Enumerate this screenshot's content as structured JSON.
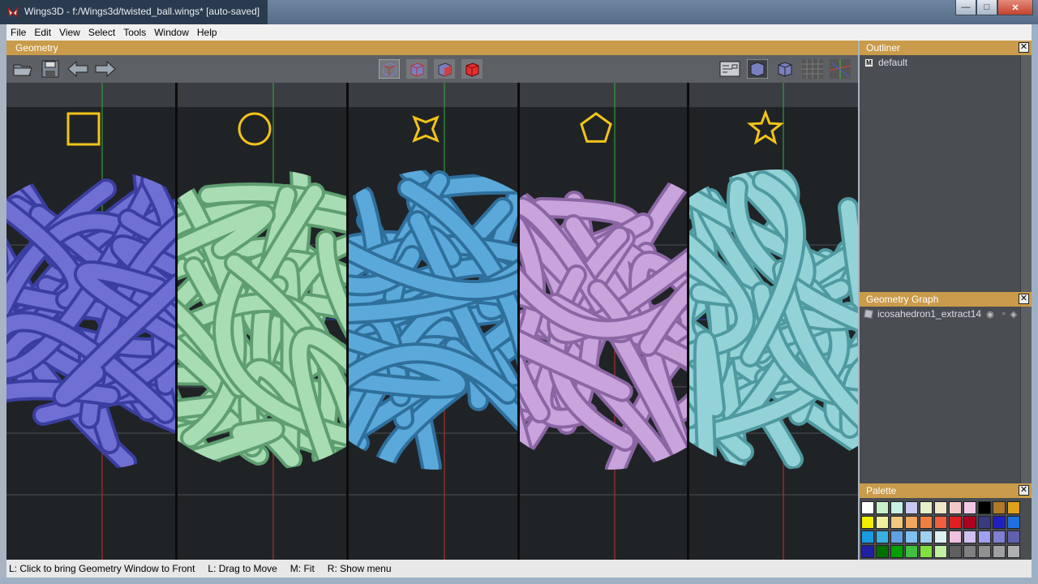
{
  "window": {
    "title": "Wings3D - f:/Wings3d/twisted_ball.wings* [auto-saved]"
  },
  "menu": [
    "File",
    "Edit",
    "View",
    "Select",
    "Tools",
    "Window",
    "Help"
  ],
  "geometry": {
    "title": "Geometry"
  },
  "toolbar": {
    "left_icons": [
      "open-icon",
      "save-icon",
      "undo-arrow-icon",
      "redo-arrow-icon"
    ],
    "center_icons": [
      "vertex-select-icon",
      "edge-select-icon",
      "face-select-icon",
      "object-select-icon"
    ],
    "right_icons": [
      "view-mode-icon",
      "smooth-shade-icon",
      "flat-shade-icon",
      "ground-icon",
      "axes-icon"
    ]
  },
  "viewports": [
    {
      "shape": "square",
      "color": "#6f6fd4",
      "dark": "#3b3ea0"
    },
    {
      "shape": "circle",
      "color": "#a8dcb2",
      "dark": "#5e9e70"
    },
    {
      "shape": "star4",
      "color": "#5aa9da",
      "dark": "#2f6f9c"
    },
    {
      "shape": "pentagon",
      "color": "#c9a3dc",
      "dark": "#8a66a3"
    },
    {
      "shape": "star5",
      "color": "#93d3d8",
      "dark": "#4f9aa0"
    }
  ],
  "outliner": {
    "title": "Outliner",
    "items": [
      "default"
    ]
  },
  "graph": {
    "title": "Geometry Graph",
    "items": [
      "icosahedron1_extract14"
    ]
  },
  "palette": {
    "title": "Palette",
    "colors": [
      "#ffffff",
      "#c8f0c8",
      "#c8f0e6",
      "#c8c8f0",
      "#e6f0c8",
      "#f0e6c8",
      "#f0c8c8",
      "#f0c8e6",
      "#000000",
      "#b07a2a",
      "#e0a01a",
      "#f0f000",
      "#f0f0a0",
      "#f0c880",
      "#f0a860",
      "#f08040",
      "#f06040",
      "#e02020",
      "#b00020",
      "#3a3a80",
      "#2020c0",
      "#2070e0",
      "#1a9ae0",
      "#3ab0e0",
      "#60a0e0",
      "#80c0f0",
      "#a0d0f0",
      "#e0f0f0",
      "#f0c0e0",
      "#d0c0f0",
      "#a0a0f0",
      "#8080d0",
      "#6060b0",
      "#2020a0",
      "#007000",
      "#00a000",
      "#40c040",
      "#80e040",
      "#c0f0a0",
      "#606060",
      "#808080",
      "#909090",
      "#a0a0a0",
      "#b0b0b0"
    ]
  },
  "status": [
    "L: Click to bring Geometry Window to Front",
    "L: Drag to Move",
    "M: Fit",
    "R: Show menu"
  ]
}
